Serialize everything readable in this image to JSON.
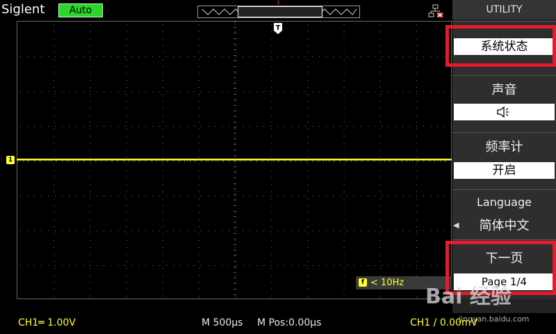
{
  "header": {
    "brand": "Siglent",
    "trigger_mode": "Auto",
    "trigger_pos_marker": "↓"
  },
  "screen": {
    "channel_marker": "1",
    "trigger_marker": "T",
    "trace_color": "#ffff2a",
    "grid_color": "#5a5a5a",
    "frequency_icon": "f",
    "frequency_readout": "< 10Hz"
  },
  "sidebar": {
    "title": "UTILITY",
    "items": [
      {
        "label": "",
        "value": "系统状态"
      },
      {
        "label": "声音",
        "value": "speaker-icon"
      },
      {
        "label": "频率计",
        "value": "开启"
      },
      {
        "label": "Language",
        "value": "简体中文"
      },
      {
        "label": "下一页",
        "value": "Page 1/4"
      }
    ],
    "highlight_color": "#e21b2d"
  },
  "footer": {
    "ch1_scale": "CH1═ 1.00V",
    "timebase": "M 500µs",
    "mpos": "M Pos:0.00µs",
    "trigger_level": "CH1 / 0.00mV"
  },
  "watermark": {
    "brand": "Bai 经验",
    "url": "jingyan.baidu.com"
  }
}
